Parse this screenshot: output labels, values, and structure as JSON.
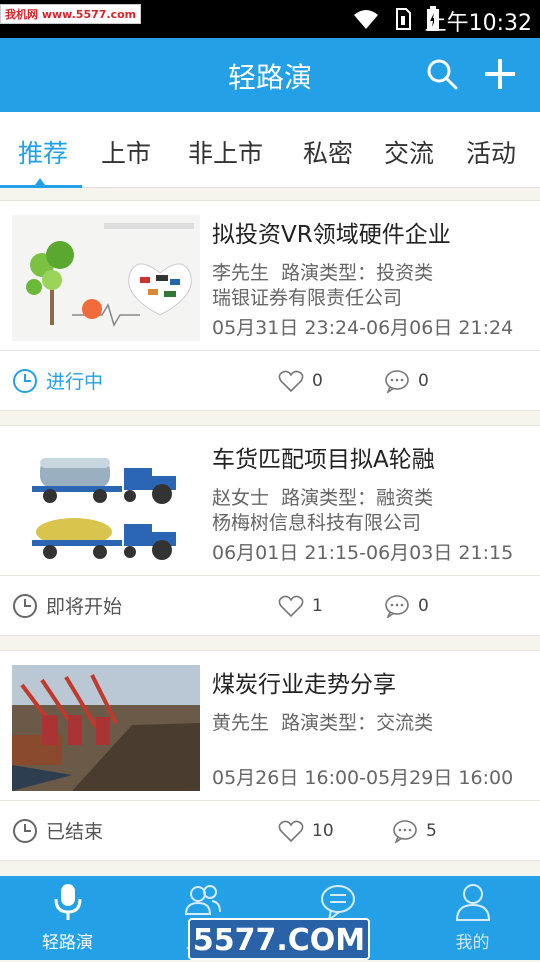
{
  "status_bar": {
    "watermark": "我机网 www.5577.com",
    "time": "上午10:32"
  },
  "app_bar": {
    "title": "轻路演"
  },
  "tabs": [
    {
      "label": "推荐"
    },
    {
      "label": "上市"
    },
    {
      "label": "非上市"
    },
    {
      "label": "私密"
    },
    {
      "label": "交流"
    },
    {
      "label": "活动"
    }
  ],
  "roadshows": [
    {
      "title": "拟投资VR领域硬件企业",
      "presenter": "李先生",
      "type": "路演类型：投资类",
      "company": "瑞银证券有限责任公司",
      "time": "05月31日 23:24-06月06日 21:24",
      "status": "进行中",
      "likes": "0",
      "comments": "0"
    },
    {
      "title": "车货匹配项目拟A轮融",
      "presenter": "赵女士",
      "type": "路演类型：融资类",
      "company": "杨梅树信息科技有限公司",
      "time": "06月01日 21:15-06月03日 21:15",
      "status": "即将开始",
      "likes": "1",
      "comments": "0"
    },
    {
      "title": "煤炭行业走势分享",
      "presenter": "黄先生",
      "type": "路演类型：交流类",
      "company": "",
      "time": "05月26日 16:00-05月29日 16:00",
      "status": "已结束",
      "likes": "10",
      "comments": "5"
    }
  ],
  "bottom_nav": [
    {
      "label": "轻路演"
    },
    {
      "label": "人脉"
    },
    {
      "label": "消息"
    },
    {
      "label": "我的"
    }
  ],
  "watermark_bottom": "5577.COM",
  "colors": {
    "accent": "#24a0e6"
  }
}
